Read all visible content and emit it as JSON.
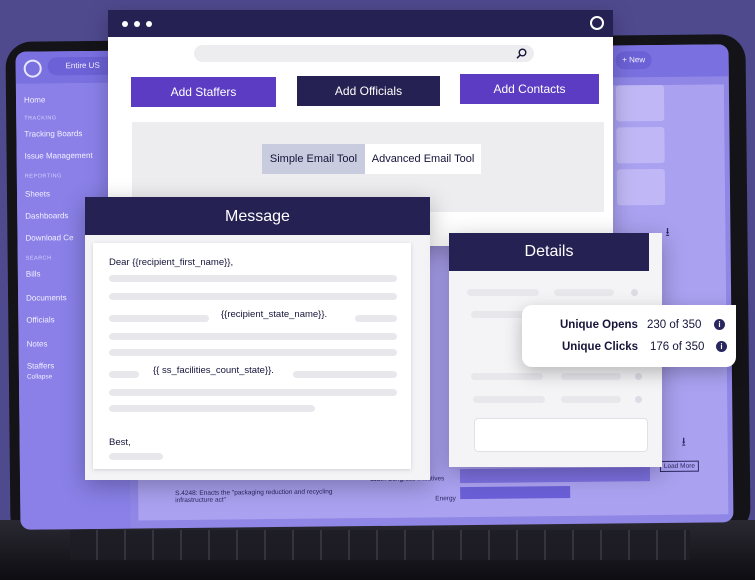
{
  "background_app": {
    "scope_pill": "Entire US",
    "new_button": "+ New",
    "sidebar": {
      "home": "Home",
      "section_tracking": "TRACKING",
      "tracking_boards": "Tracking Boards",
      "issue_management": "Issue Management",
      "section_reporting": "REPORTING",
      "sheets": "Sheets",
      "dashboards": "Dashboards",
      "download_center": "Download Ce",
      "section_search": "SEARCH",
      "bills": "Bills",
      "documents": "Documents",
      "officials": "Officials",
      "notes": "Notes",
      "staffers": "Staffers",
      "collapse": "Collapse"
    },
    "bottom_text": "118th Congress Initiatives",
    "bottom_text2": "Energy",
    "bill_text": "S.4248: Enacts the \"packaging reduction and recycling infrastructure act\"",
    "load_more": "Load More"
  },
  "main_window": {
    "buttons": {
      "add_staffers": "Add Staffers",
      "add_officials": "Add Officials",
      "add_contacts": "Add Contacts"
    },
    "tabs": {
      "simple": "Simple Email Tool",
      "advanced": "Advanced Email Tool"
    }
  },
  "message": {
    "title": "Message",
    "greeting": "Dear {{recipient_first_name}},",
    "var_state": "{{recipient_state_name}}.",
    "var_facilities": "{{ ss_facilities_count_state}}.",
    "closing": "Best,"
  },
  "details": {
    "title": "Details",
    "stats": [
      {
        "label": "Unique Opens",
        "value": "230 of 350"
      },
      {
        "label": "Unique Clicks",
        "value": "176 of 350"
      }
    ]
  },
  "colors": {
    "navy": "#252152",
    "purple": "#5a3fc0",
    "app_violet": "#8f86e6"
  },
  "icons": [
    "search-icon",
    "app-logo-icon",
    "info-icon",
    "download-icon"
  ]
}
